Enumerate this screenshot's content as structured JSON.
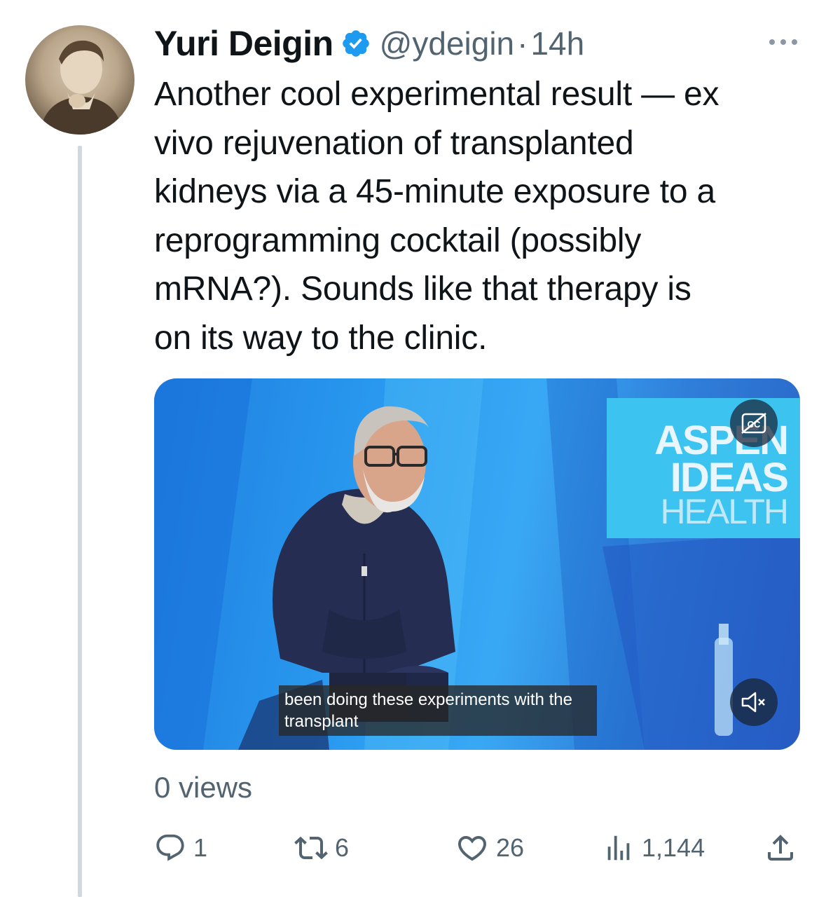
{
  "tweet": {
    "author_name": "Yuri Deigin",
    "handle": "@ydeigin",
    "separator": "·",
    "time": "14h",
    "text": "Another cool experimental result — ex\nvivo rejuvenation of transplanted\nkidneys via a 45-minute exposure to a\nreprogramming cocktail (possibly\nmRNA?). Sounds like that therapy is\non its way to the clinic.",
    "views": "0 views"
  },
  "media": {
    "brand_line1": "ASPEN",
    "brand_line2": "IDEAS",
    "brand_line3": "HEALTH",
    "caption": "been doing these experiments with the\ntransplant"
  },
  "actions": {
    "replies": "1",
    "reposts": "6",
    "likes": "26",
    "views_count": "1,144"
  },
  "icons": {
    "verified": "verified-badge-icon",
    "more": "more-icon",
    "cc": "closed-captions-icon",
    "mute": "muted-speaker-icon",
    "reply": "reply-icon",
    "repost": "repost-icon",
    "like": "heart-icon",
    "analytics": "analytics-icon",
    "share": "share-icon"
  },
  "colors": {
    "verified": "#1d9bf0",
    "secondary_text": "#536471",
    "thread_line": "#cfd9de"
  }
}
